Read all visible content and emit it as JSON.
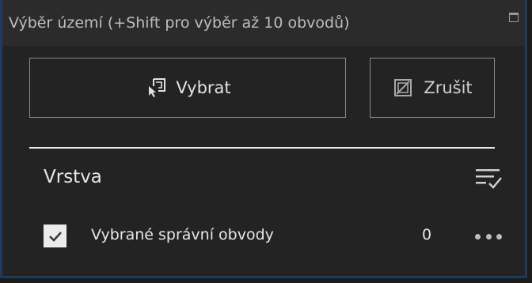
{
  "header": {
    "title": "Výběr území (+Shift pro výběr až 10 obvodů)",
    "maximize_icon": "maximize-icon"
  },
  "buttons": {
    "select_label": "Vybrat",
    "select_icon": "select-pointer-icon",
    "clear_label": "Zrušit",
    "clear_icon": "clear-selection-icon"
  },
  "layers": {
    "title": "Vrstva",
    "filter_icon": "filter-list-icon",
    "items": [
      {
        "checked": true,
        "label": "Vybrané správní obvody",
        "count": "0",
        "more_icon": "more-options-icon"
      }
    ]
  },
  "colors": {
    "panel_bg": "#232323",
    "header_bg": "#2b2b2b",
    "border_accent": "#1e3a5c",
    "text": "#e6e6e6"
  }
}
